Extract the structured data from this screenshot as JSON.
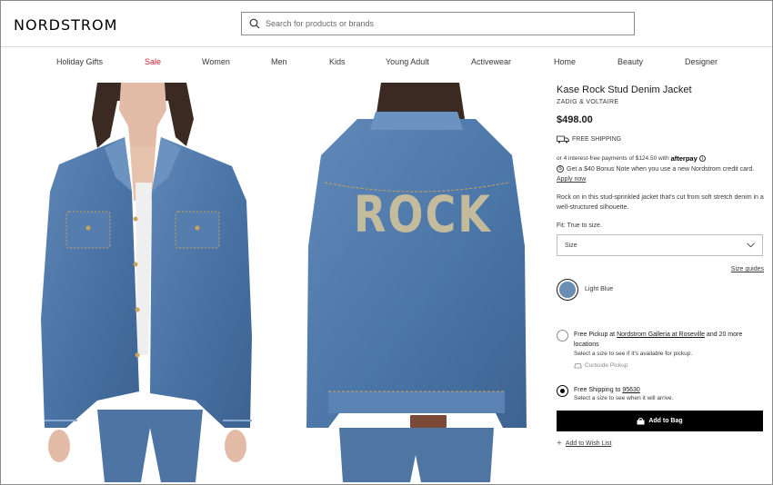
{
  "header": {
    "logo": "NORDSTROM",
    "search_placeholder": "Search for products or brands"
  },
  "nav": {
    "items": [
      "Holiday Gifts",
      "Sale",
      "Women",
      "Men",
      "Kids",
      "Young Adult",
      "Activewear",
      "Home",
      "Beauty",
      "Designer"
    ]
  },
  "product": {
    "title": "Kase Rock Stud Denim Jacket",
    "brand": "ZADIG & VOLTAIRE",
    "price": "$498.00",
    "free_shipping": "FREE SHIPPING",
    "afterpay_text": "or 4 interest-free payments of $124.50 with",
    "afterpay_brand": "afterpay",
    "bonus_text": "Get a $40 Bonus Note when you use a new Nordstrom credit card.",
    "apply_now": "Apply now",
    "description": "Rock on in this stud-sprinkled jacket that's cut from soft stretch denim in a well-structured silhouette.",
    "fit": "Fit: True to size.",
    "size_placeholder": "Size",
    "size_guides": "Size guides",
    "color_name": "Light Blue",
    "color_hex": "#6b8fb4",
    "back_print": "ROCK"
  },
  "fulfillment": {
    "pickup_prefix": "Free Pickup at",
    "pickup_store": "Nordstrom Galleria at Roseville",
    "pickup_suffix": "and 20 more locations",
    "pickup_sub": "Select a size to see if it's available for pickup.",
    "curbside": "Curbside Pickup",
    "shipping_prefix": "Free Shipping to",
    "shipping_zip": "95630",
    "shipping_sub": "Select a size to see when it will arrive."
  },
  "actions": {
    "add_to_bag": "Add to Bag",
    "add_to_wishlist": "Add to Wish List"
  },
  "colors": {
    "sale": "#d41e32",
    "button": "#000000"
  }
}
